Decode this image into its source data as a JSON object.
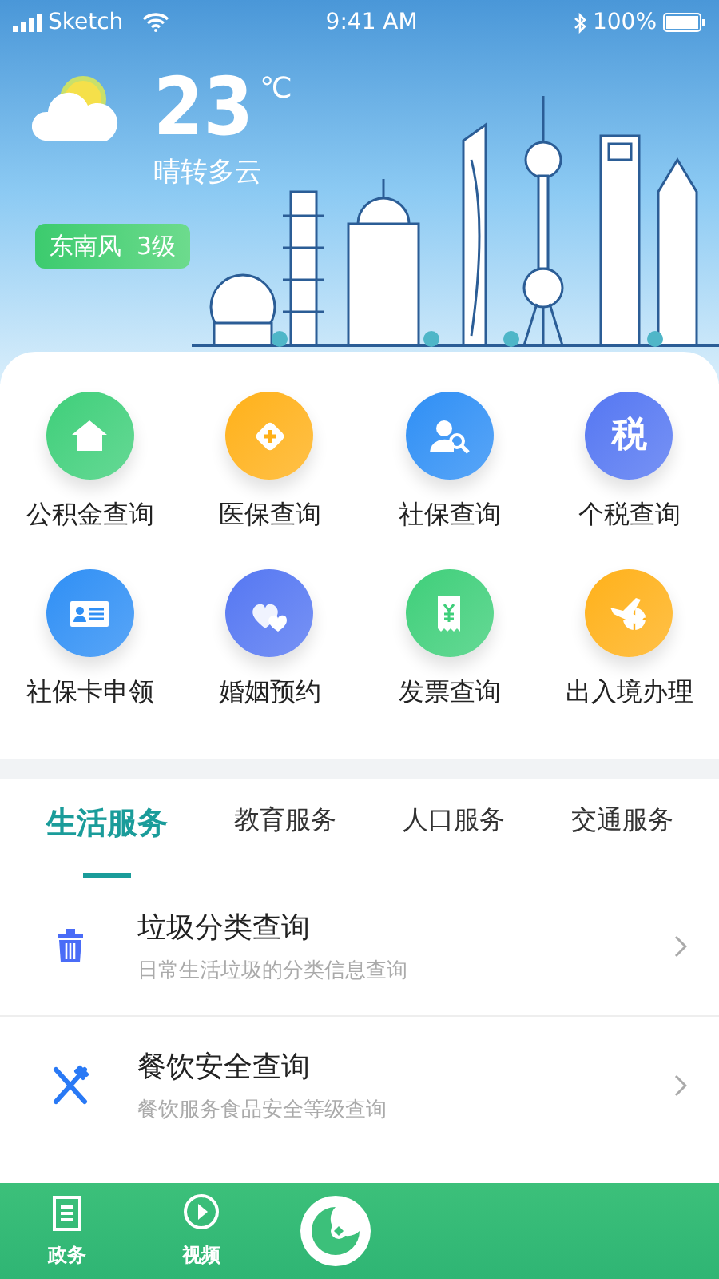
{
  "status_bar": {
    "carrier": "Sketch",
    "time": "9:41 AM",
    "battery": "100%"
  },
  "weather": {
    "temperature": "23",
    "unit": "℃",
    "description": "晴转多云",
    "wind": "东南风  3级"
  },
  "services": [
    {
      "label": "公积金查询",
      "color": "#3fcf7a"
    },
    {
      "label": "医保查询",
      "color": "#ffb11a"
    },
    {
      "label": "社保查询",
      "color": "#2f8ff5"
    },
    {
      "label": "个税查询",
      "glyph": "税",
      "color": "#5577f2"
    },
    {
      "label": "社保卡申领",
      "color": "#2f8ff5"
    },
    {
      "label": "婚姻预约",
      "color": "#5577f2"
    },
    {
      "label": "发票查询",
      "color": "#3fcf7a"
    },
    {
      "label": "出入境办理",
      "color": "#ffb11a"
    }
  ],
  "tabs": [
    {
      "label": "生活服务",
      "selected": true
    },
    {
      "label": "教育服务",
      "selected": false
    },
    {
      "label": "人口服务",
      "selected": false
    },
    {
      "label": "交通服务",
      "selected": false
    }
  ],
  "list_items": [
    {
      "title": "垃圾分类查询",
      "subtitle": "日常生活垃圾的分类信息查询"
    },
    {
      "title": "餐饮安全查询",
      "subtitle": "餐饮服务食品安全等级查询"
    }
  ],
  "bottom_nav": [
    {
      "label": "政务"
    },
    {
      "label": "视频"
    }
  ]
}
